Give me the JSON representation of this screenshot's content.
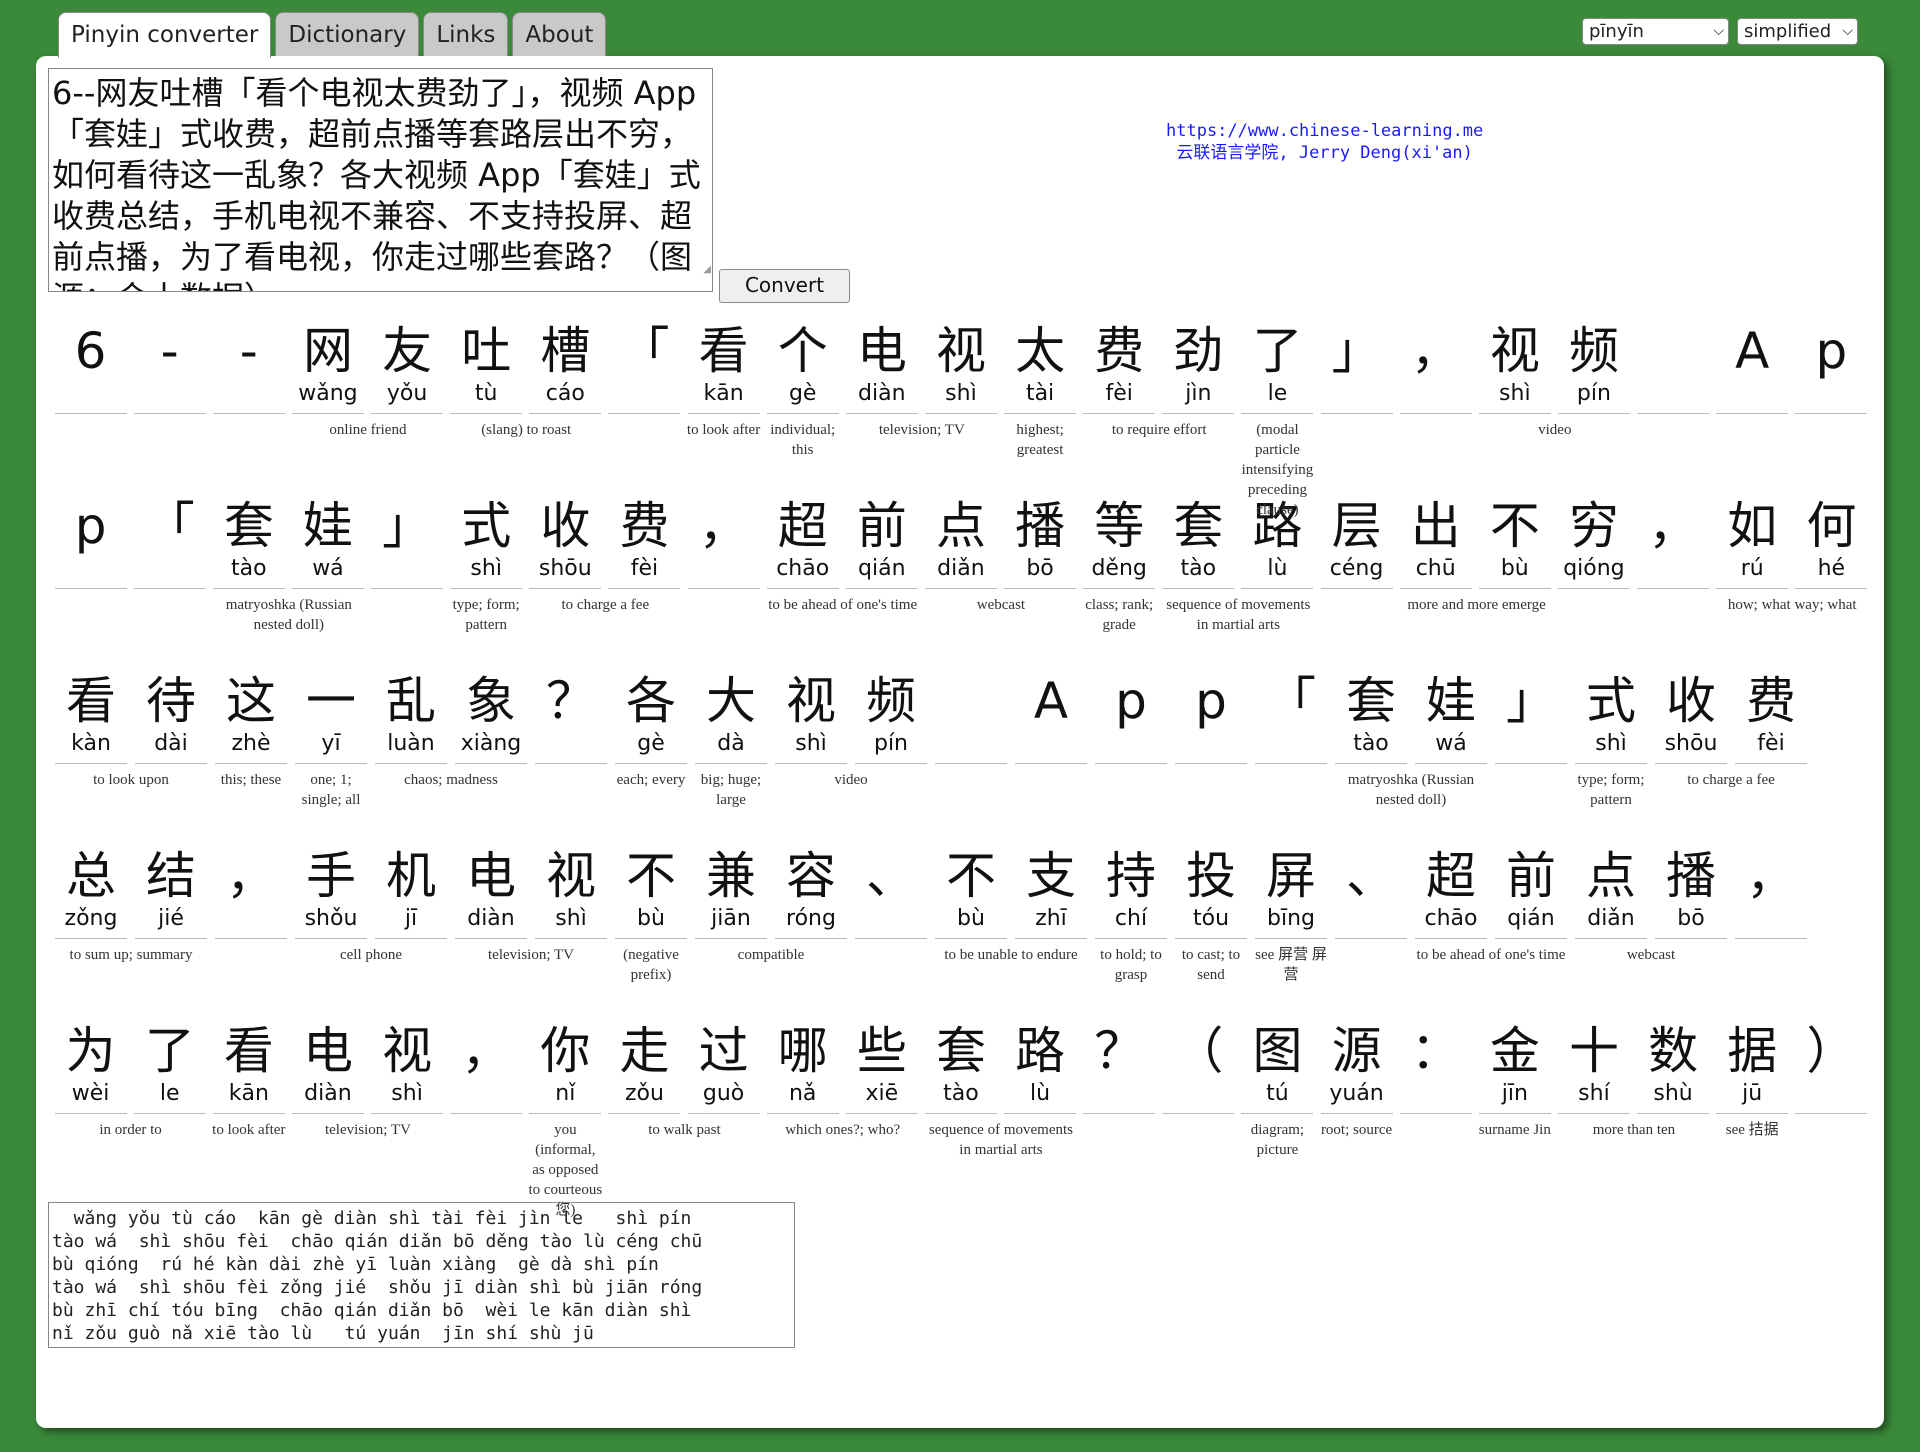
{
  "tabs": [
    "Pinyin converter",
    "Dictionary",
    "Links",
    "About"
  ],
  "selects": {
    "mode": "pīnyīn",
    "script": "simplified"
  },
  "input_text": "6--网友吐槽「看个电视太费劲了」，视频 App「套娃」式收费，超前点播等套路层出不穷，如何看待这一乱象？各大视频 App「套娃」式收费总结，手机电视不兼容、不支持投屏、超前点播，为了看电视，你走过哪些套路？（图源：金十数据）",
  "convert_label": "Convert",
  "credit": {
    "line1": "https://www.chinese-learning.me",
    "line2": "云联语言学院, Jerry Deng(xi'an)"
  },
  "rows": [
    {
      "chars": [
        {
          "h": "6",
          "p": ""
        },
        {
          "h": "-",
          "p": ""
        },
        {
          "h": "-",
          "p": ""
        },
        {
          "h": "网",
          "p": "wǎng",
          "g": "online friend",
          "span": 2
        },
        {
          "h": "友",
          "p": "yǒu"
        },
        {
          "h": "吐",
          "p": "tù",
          "g": "(slang) to roast",
          "span": 2
        },
        {
          "h": "槽",
          "p": "cáo"
        },
        {
          "h": "「",
          "p": ""
        },
        {
          "h": "看",
          "p": "kān",
          "g": "to look after"
        },
        {
          "h": "个",
          "p": "gè",
          "g": "individual; this"
        },
        {
          "h": "电",
          "p": "diàn",
          "g": "television; TV",
          "span": 2
        },
        {
          "h": "视",
          "p": "shì"
        },
        {
          "h": "太",
          "p": "tài",
          "g": "highest; greatest"
        },
        {
          "h": "费",
          "p": "fèi",
          "g": "to require effort",
          "span": 2
        },
        {
          "h": "劲",
          "p": "jìn"
        },
        {
          "h": "了",
          "p": "le",
          "g": "(modal particle intensifying preceding clause)"
        },
        {
          "h": "」",
          "p": ""
        },
        {
          "h": "，",
          "p": ""
        },
        {
          "h": "视",
          "p": "shì",
          "g": "video",
          "span": 2
        },
        {
          "h": "频",
          "p": "pín"
        },
        {
          "h": " ",
          "p": ""
        },
        {
          "h": "A",
          "p": ""
        },
        {
          "h": "p",
          "p": ""
        }
      ]
    },
    {
      "chars": [
        {
          "h": "p",
          "p": ""
        },
        {
          "h": "「",
          "p": ""
        },
        {
          "h": "套",
          "p": "tào",
          "g": "matryoshka (Russian nested doll)",
          "span": 2
        },
        {
          "h": "娃",
          "p": "wá"
        },
        {
          "h": "」",
          "p": ""
        },
        {
          "h": "式",
          "p": "shì",
          "g": "type; form; pattern"
        },
        {
          "h": "收",
          "p": "shōu",
          "g": "to charge a fee",
          "span": 2
        },
        {
          "h": "费",
          "p": "fèi"
        },
        {
          "h": "，",
          "p": ""
        },
        {
          "h": "超",
          "p": "chāo",
          "g": "to be ahead of one's time",
          "span": 2
        },
        {
          "h": "前",
          "p": "qián"
        },
        {
          "h": "点",
          "p": "diǎn",
          "g": "webcast",
          "span": 2
        },
        {
          "h": "播",
          "p": "bō"
        },
        {
          "h": "等",
          "p": "děng",
          "g": "class; rank; grade"
        },
        {
          "h": "套",
          "p": "tào",
          "g": "sequence of movements in martial arts",
          "span": 2
        },
        {
          "h": "路",
          "p": "lù"
        },
        {
          "h": "层",
          "p": "céng",
          "g": "more and more emerge",
          "span": 4
        },
        {
          "h": "出",
          "p": "chū"
        },
        {
          "h": "不",
          "p": "bù"
        },
        {
          "h": "穷",
          "p": "qióng"
        },
        {
          "h": "，",
          "p": ""
        },
        {
          "h": "如",
          "p": "rú",
          "g": "how; what way; what",
          "span": 2
        },
        {
          "h": "何",
          "p": "hé"
        }
      ]
    },
    {
      "chars": [
        {
          "h": "看",
          "p": "kàn",
          "g": "to look upon",
          "span": 2
        },
        {
          "h": "待",
          "p": "dài"
        },
        {
          "h": "这",
          "p": "zhè",
          "g": "this; these"
        },
        {
          "h": "一",
          "p": "yī",
          "g": "one; 1; single; all"
        },
        {
          "h": "乱",
          "p": "luàn",
          "g": "chaos; madness",
          "span": 2
        },
        {
          "h": "象",
          "p": "xiàng"
        },
        {
          "h": "？",
          "p": ""
        },
        {
          "h": "各",
          "p": "gè",
          "g": "each; every"
        },
        {
          "h": "大",
          "p": "dà",
          "g": "big; huge; large"
        },
        {
          "h": "视",
          "p": "shì",
          "g": "video",
          "span": 2
        },
        {
          "h": "频",
          "p": "pín"
        },
        {
          "h": " ",
          "p": ""
        },
        {
          "h": "A",
          "p": ""
        },
        {
          "h": "p",
          "p": ""
        },
        {
          "h": "p",
          "p": ""
        },
        {
          "h": "「",
          "p": ""
        },
        {
          "h": "套",
          "p": "tào",
          "g": "matryoshka (Russian nested doll)",
          "span": 2
        },
        {
          "h": "娃",
          "p": "wá"
        },
        {
          "h": "」",
          "p": ""
        },
        {
          "h": "式",
          "p": "shì",
          "g": "type; form; pattern"
        },
        {
          "h": "收",
          "p": "shōu",
          "g": "to charge a fee",
          "span": 2
        },
        {
          "h": "费",
          "p": "fèi"
        }
      ]
    },
    {
      "chars": [
        {
          "h": "总",
          "p": "zǒng",
          "g": "to sum up; summary",
          "span": 2
        },
        {
          "h": "结",
          "p": "jié"
        },
        {
          "h": "，",
          "p": ""
        },
        {
          "h": "手",
          "p": "shǒu",
          "g": "cell phone",
          "span": 2
        },
        {
          "h": "机",
          "p": "jī"
        },
        {
          "h": "电",
          "p": "diàn",
          "g": "television; TV",
          "span": 2
        },
        {
          "h": "视",
          "p": "shì"
        },
        {
          "h": "不",
          "p": "bù",
          "g": "(negative prefix)"
        },
        {
          "h": "兼",
          "p": "jiān",
          "g": "compatible",
          "span": 2
        },
        {
          "h": "容",
          "p": "róng"
        },
        {
          "h": "、",
          "p": ""
        },
        {
          "h": "不",
          "p": "bù",
          "g": "to be unable to endure",
          "span": 2
        },
        {
          "h": "支",
          "p": "zhī"
        },
        {
          "h": "持",
          "p": "chí",
          "g": "to hold; to grasp"
        },
        {
          "h": "投",
          "p": "tóu",
          "g": "to cast; to send"
        },
        {
          "h": "屏",
          "p": "bīng",
          "g": "see 屏营 屏营"
        },
        {
          "h": "、",
          "p": ""
        },
        {
          "h": "超",
          "p": "chāo",
          "g": "to be ahead of one's time",
          "span": 2
        },
        {
          "h": "前",
          "p": "qián"
        },
        {
          "h": "点",
          "p": "diǎn",
          "g": "webcast",
          "span": 2
        },
        {
          "h": "播",
          "p": "bō"
        },
        {
          "h": "，",
          "p": ""
        }
      ]
    },
    {
      "chars": [
        {
          "h": "为",
          "p": "wèi",
          "g": "in order to",
          "span": 2
        },
        {
          "h": "了",
          "p": "le"
        },
        {
          "h": "看",
          "p": "kān",
          "g": "to look after"
        },
        {
          "h": "电",
          "p": "diàn",
          "g": "television; TV",
          "span": 2
        },
        {
          "h": "视",
          "p": "shì"
        },
        {
          "h": "，",
          "p": ""
        },
        {
          "h": "你",
          "p": "nǐ",
          "g": "you (informal, as opposed to courteous 您)"
        },
        {
          "h": "走",
          "p": "zǒu",
          "g": "to walk past",
          "span": 2
        },
        {
          "h": "过",
          "p": "guò"
        },
        {
          "h": "哪",
          "p": "nǎ",
          "g": "which ones?; who?",
          "span": 2
        },
        {
          "h": "些",
          "p": "xiē"
        },
        {
          "h": "套",
          "p": "tào",
          "g": "sequence of movements in martial arts",
          "span": 2
        },
        {
          "h": "路",
          "p": "lù"
        },
        {
          "h": "？",
          "p": ""
        },
        {
          "h": "（",
          "p": ""
        },
        {
          "h": "图",
          "p": "tú",
          "g": "diagram; picture"
        },
        {
          "h": "源",
          "p": "yuán",
          "g": "root; source"
        },
        {
          "h": "：",
          "p": ""
        },
        {
          "h": "金",
          "p": "jīn",
          "g": "surname Jin"
        },
        {
          "h": "十",
          "p": "shí",
          "g": "more than ten",
          "span": 2
        },
        {
          "h": "数",
          "p": "shù"
        },
        {
          "h": "据",
          "p": "jū",
          "g": "see 拮据"
        },
        {
          "h": "）",
          "p": ""
        }
      ]
    }
  ],
  "output_lines": [
    "  wǎng yǒu tù cáo  kān gè diàn shì tài fèi jìn le   shì pín",
    "tào wá  shì shōu fèi  chāo qián diǎn bō děng tào lù céng chū",
    "bù qióng  rú hé kàn dài zhè yī luàn xiàng  gè dà shì pín",
    "tào wá  shì shōu fèi zǒng jié  shǒu jī diàn shì bù jiān róng",
    "bù zhī chí tóu bīng  chāo qián diǎn bō  wèi le kān diàn shì",
    "nǐ zǒu guò nǎ xiē tào lù   tú yuán  jīn shí shù jū"
  ]
}
